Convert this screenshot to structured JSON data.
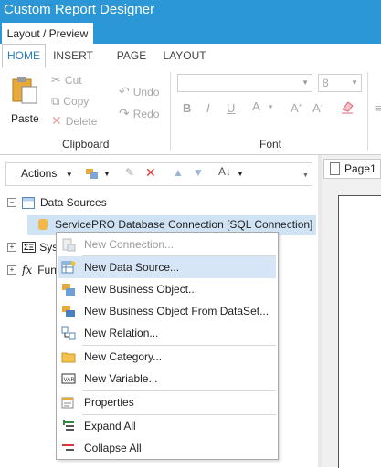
{
  "window": {
    "title": "Custom Report Designer"
  },
  "doc_tabs": {
    "active": "Layout / Preview"
  },
  "ribbon_tabs": [
    "HOME",
    "INSERT",
    "PAGE",
    "LAYOUT"
  ],
  "ribbon": {
    "clipboard": {
      "paste": "Paste",
      "cut": "Cut",
      "copy": "Copy",
      "delete": "Delete",
      "label": "Clipboard"
    },
    "history": {
      "undo": "Undo",
      "redo": "Redo"
    },
    "font": {
      "size": "8",
      "label": "Font",
      "bold": "B",
      "italic": "I",
      "underline": "U",
      "color": "A"
    }
  },
  "toolbar": {
    "actions": "Actions"
  },
  "tree": {
    "data_sources": "Data Sources",
    "connection": "ServicePRO Database Connection [SQL Connection]",
    "system": "Syst",
    "functions": "Fun"
  },
  "context_menu": {
    "new_connection": "New Connection...",
    "new_data_source": "New Data Source...",
    "new_business_object": "New Business Object...",
    "new_business_object_dataset": "New Business Object From DataSet...",
    "new_relation": "New Relation...",
    "new_category": "New Category...",
    "new_variable": "New Variable...",
    "properties": "Properties",
    "expand_all": "Expand All",
    "collapse_all": "Collapse All"
  },
  "right_panel": {
    "page_tab": "Page1"
  },
  "colors": {
    "accent": "#2b97d6",
    "hover": "#d7e6f6",
    "selected": "#cfe3f5"
  }
}
